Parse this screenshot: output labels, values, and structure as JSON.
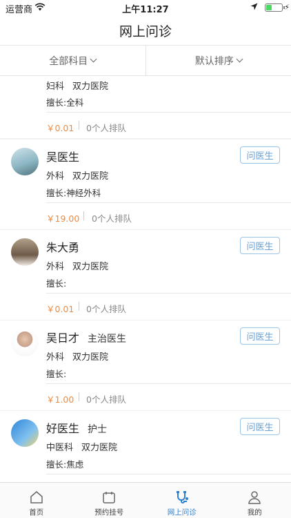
{
  "status_bar": {
    "carrier": "运营商",
    "time": "上午11:27"
  },
  "nav": {
    "title": "网上问诊"
  },
  "filters": {
    "department": "全部科目",
    "sort": "默认排序"
  },
  "doctors": [
    {
      "name": "",
      "title": "",
      "department": "妇科",
      "hospital": "双力医院",
      "specialty": "擅长:全科",
      "price": "￥0.01",
      "queue": "0个人排队",
      "ask_label": ""
    },
    {
      "name": "吴医生",
      "title": "",
      "department": "外科",
      "hospital": "双力医院",
      "specialty": "擅长:神经外科",
      "price": "￥19.00",
      "queue": "0个人排队",
      "ask_label": "问医生"
    },
    {
      "name": "朱大勇",
      "title": "",
      "department": "外科",
      "hospital": "双力医院",
      "specialty": "擅长:",
      "price": "￥0.01",
      "queue": "0个人排队",
      "ask_label": "问医生"
    },
    {
      "name": "吴日才",
      "title": "主治医生",
      "department": "外科",
      "hospital": "双力医院",
      "specialty": "擅长:",
      "price": "￥1.00",
      "queue": "0个人排队",
      "ask_label": "问医生"
    },
    {
      "name": "好医生",
      "title": "护士",
      "department": "中医科",
      "hospital": "双力医院",
      "specialty": "擅长:焦虑",
      "price": "",
      "queue": "",
      "ask_label": "问医生"
    }
  ],
  "tabs": [
    {
      "label": "首页",
      "icon": "home-icon"
    },
    {
      "label": "预约挂号",
      "icon": "calendar-icon"
    },
    {
      "label": "网上问诊",
      "icon": "consult-icon"
    },
    {
      "label": "我的",
      "icon": "profile-icon"
    }
  ],
  "colors": {
    "accent": "#2f7fd1",
    "price": "#f08a3c",
    "button_border": "#9cc3e8"
  }
}
